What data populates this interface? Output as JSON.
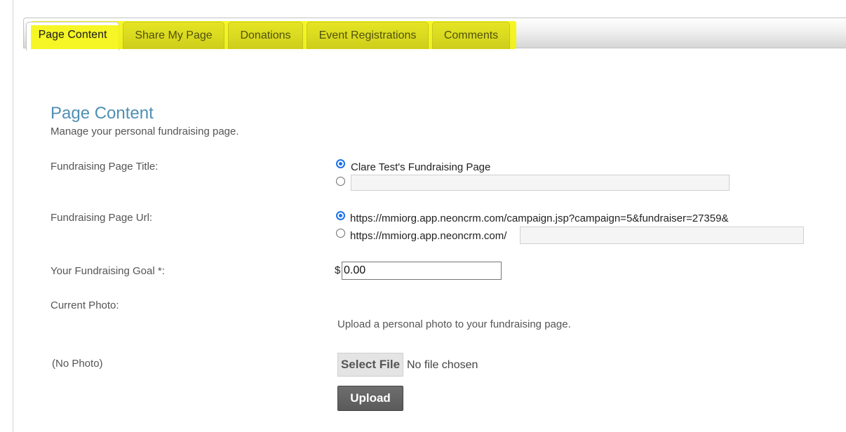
{
  "tabs": [
    {
      "label": "Page Content",
      "active": true
    },
    {
      "label": "Share My Page",
      "active": false
    },
    {
      "label": "Donations",
      "active": false
    },
    {
      "label": "Event Registrations",
      "active": false
    },
    {
      "label": "Comments",
      "active": false
    }
  ],
  "highlight_color": "#f5f500",
  "section": {
    "title": "Page Content",
    "subtitle": "Manage your personal fundraising page."
  },
  "form": {
    "title_label": "Fundraising Page Title:",
    "title_option_default": "Clare Test's Fundraising Page",
    "title_custom_value": "",
    "url_label": "Fundraising Page Url:",
    "url_option_default": "https://mmiorg.app.neoncrm.com/campaign.jsp?campaign=5&fundraiser=27359&",
    "url_option_custom_prefix": "https://mmiorg.app.neoncrm.com/",
    "url_custom_value": "",
    "goal_label": "Your Fundraising Goal *:",
    "currency_symbol": "$",
    "goal_value": "0.00",
    "photo_label": "Current Photo:",
    "photo_help": "Upload a personal photo to your fundraising page.",
    "photo_status": "(No Photo)",
    "select_file_label": "Select File",
    "no_file_text": "No file chosen",
    "upload_label": "Upload"
  }
}
